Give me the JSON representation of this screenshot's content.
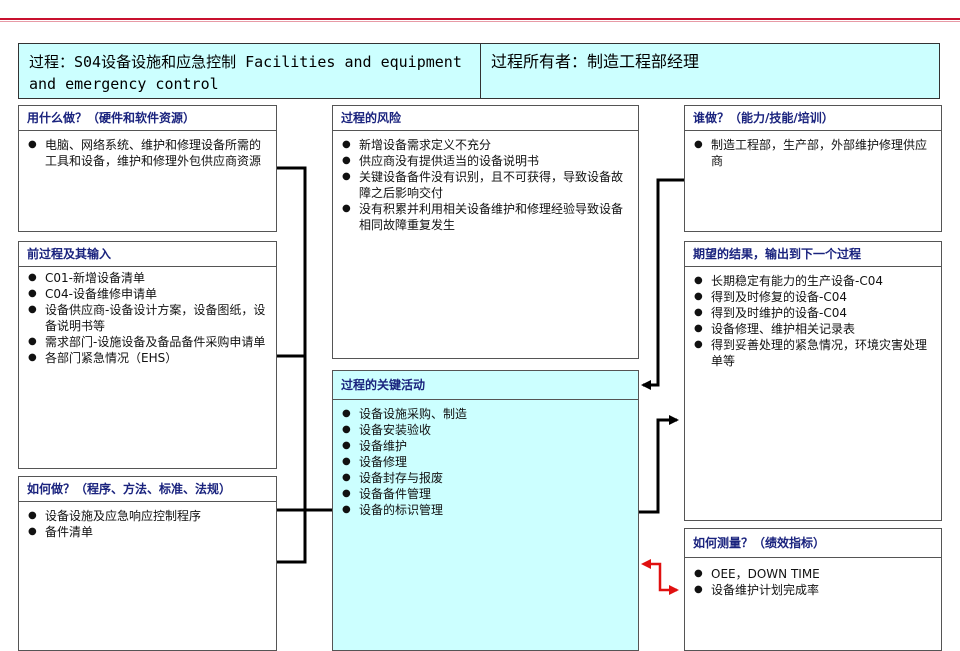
{
  "header": {
    "process_title": "过程：S04设备设施和应急控制 Facilities and equipment and emergency control",
    "owner": "过程所有者：制造工程部经理"
  },
  "resources": {
    "title": "用什么做？（硬件和软件资源）",
    "items": [
      "电脑、网络系统、维护和修理设备所需的工具和设备，维护和修理外包供应商资源"
    ]
  },
  "inputs": {
    "title": "前过程及其输入",
    "items": [
      "C01-新增设备清单",
      "C04-设备维修申请单",
      "设备供应商-设备设计方案，设备图纸，设备说明书等",
      "需求部门-设施设备及备品备件采购申请单",
      "各部门紧急情况（EHS）"
    ]
  },
  "methods": {
    "title": "如何做？（程序、方法、标准、法规）",
    "items": [
      "设备设施及应急响应控制程序",
      "备件清单"
    ]
  },
  "risks": {
    "title": "过程的风险",
    "items": [
      "新增设备需求定义不充分",
      "供应商没有提供适当的设备说明书",
      "关键设备备件没有识别，且不可获得，导致设备故障之后影响交付",
      "没有积累并利用相关设备维护和修理经验导致设备相同故障重复发生"
    ]
  },
  "activities": {
    "title": "过程的关键活动",
    "items": [
      "设备设施采购、制造",
      "设备安装验收",
      "设备维护",
      "设备修理",
      "设备封存与报废",
      "设备备件管理",
      "设备的标识管理"
    ]
  },
  "who": {
    "title": "谁做？（能力/技能/培训）",
    "items": [
      "制造工程部，生产部，外部维护修理供应商"
    ]
  },
  "outputs": {
    "title": "期望的结果，输出到下一个过程",
    "items": [
      "长期稳定有能力的生产设备-C04",
      "得到及时修复的设备-C04",
      "得到及时维护的设备-C04",
      "设备修理、维护相关记录表",
      "得到妥善处理的紧急情况，环境灾害处理单等"
    ]
  },
  "measures": {
    "title": "如何测量？（绩效指标）",
    "items": [
      "OEE，DOWN TIME",
      "设备维护计划完成率"
    ]
  },
  "colors": {
    "accent_line": "#c8102e",
    "header_fill": "#ccffff",
    "title_text": "#1a237e",
    "measure_arrow": "#e01010"
  }
}
